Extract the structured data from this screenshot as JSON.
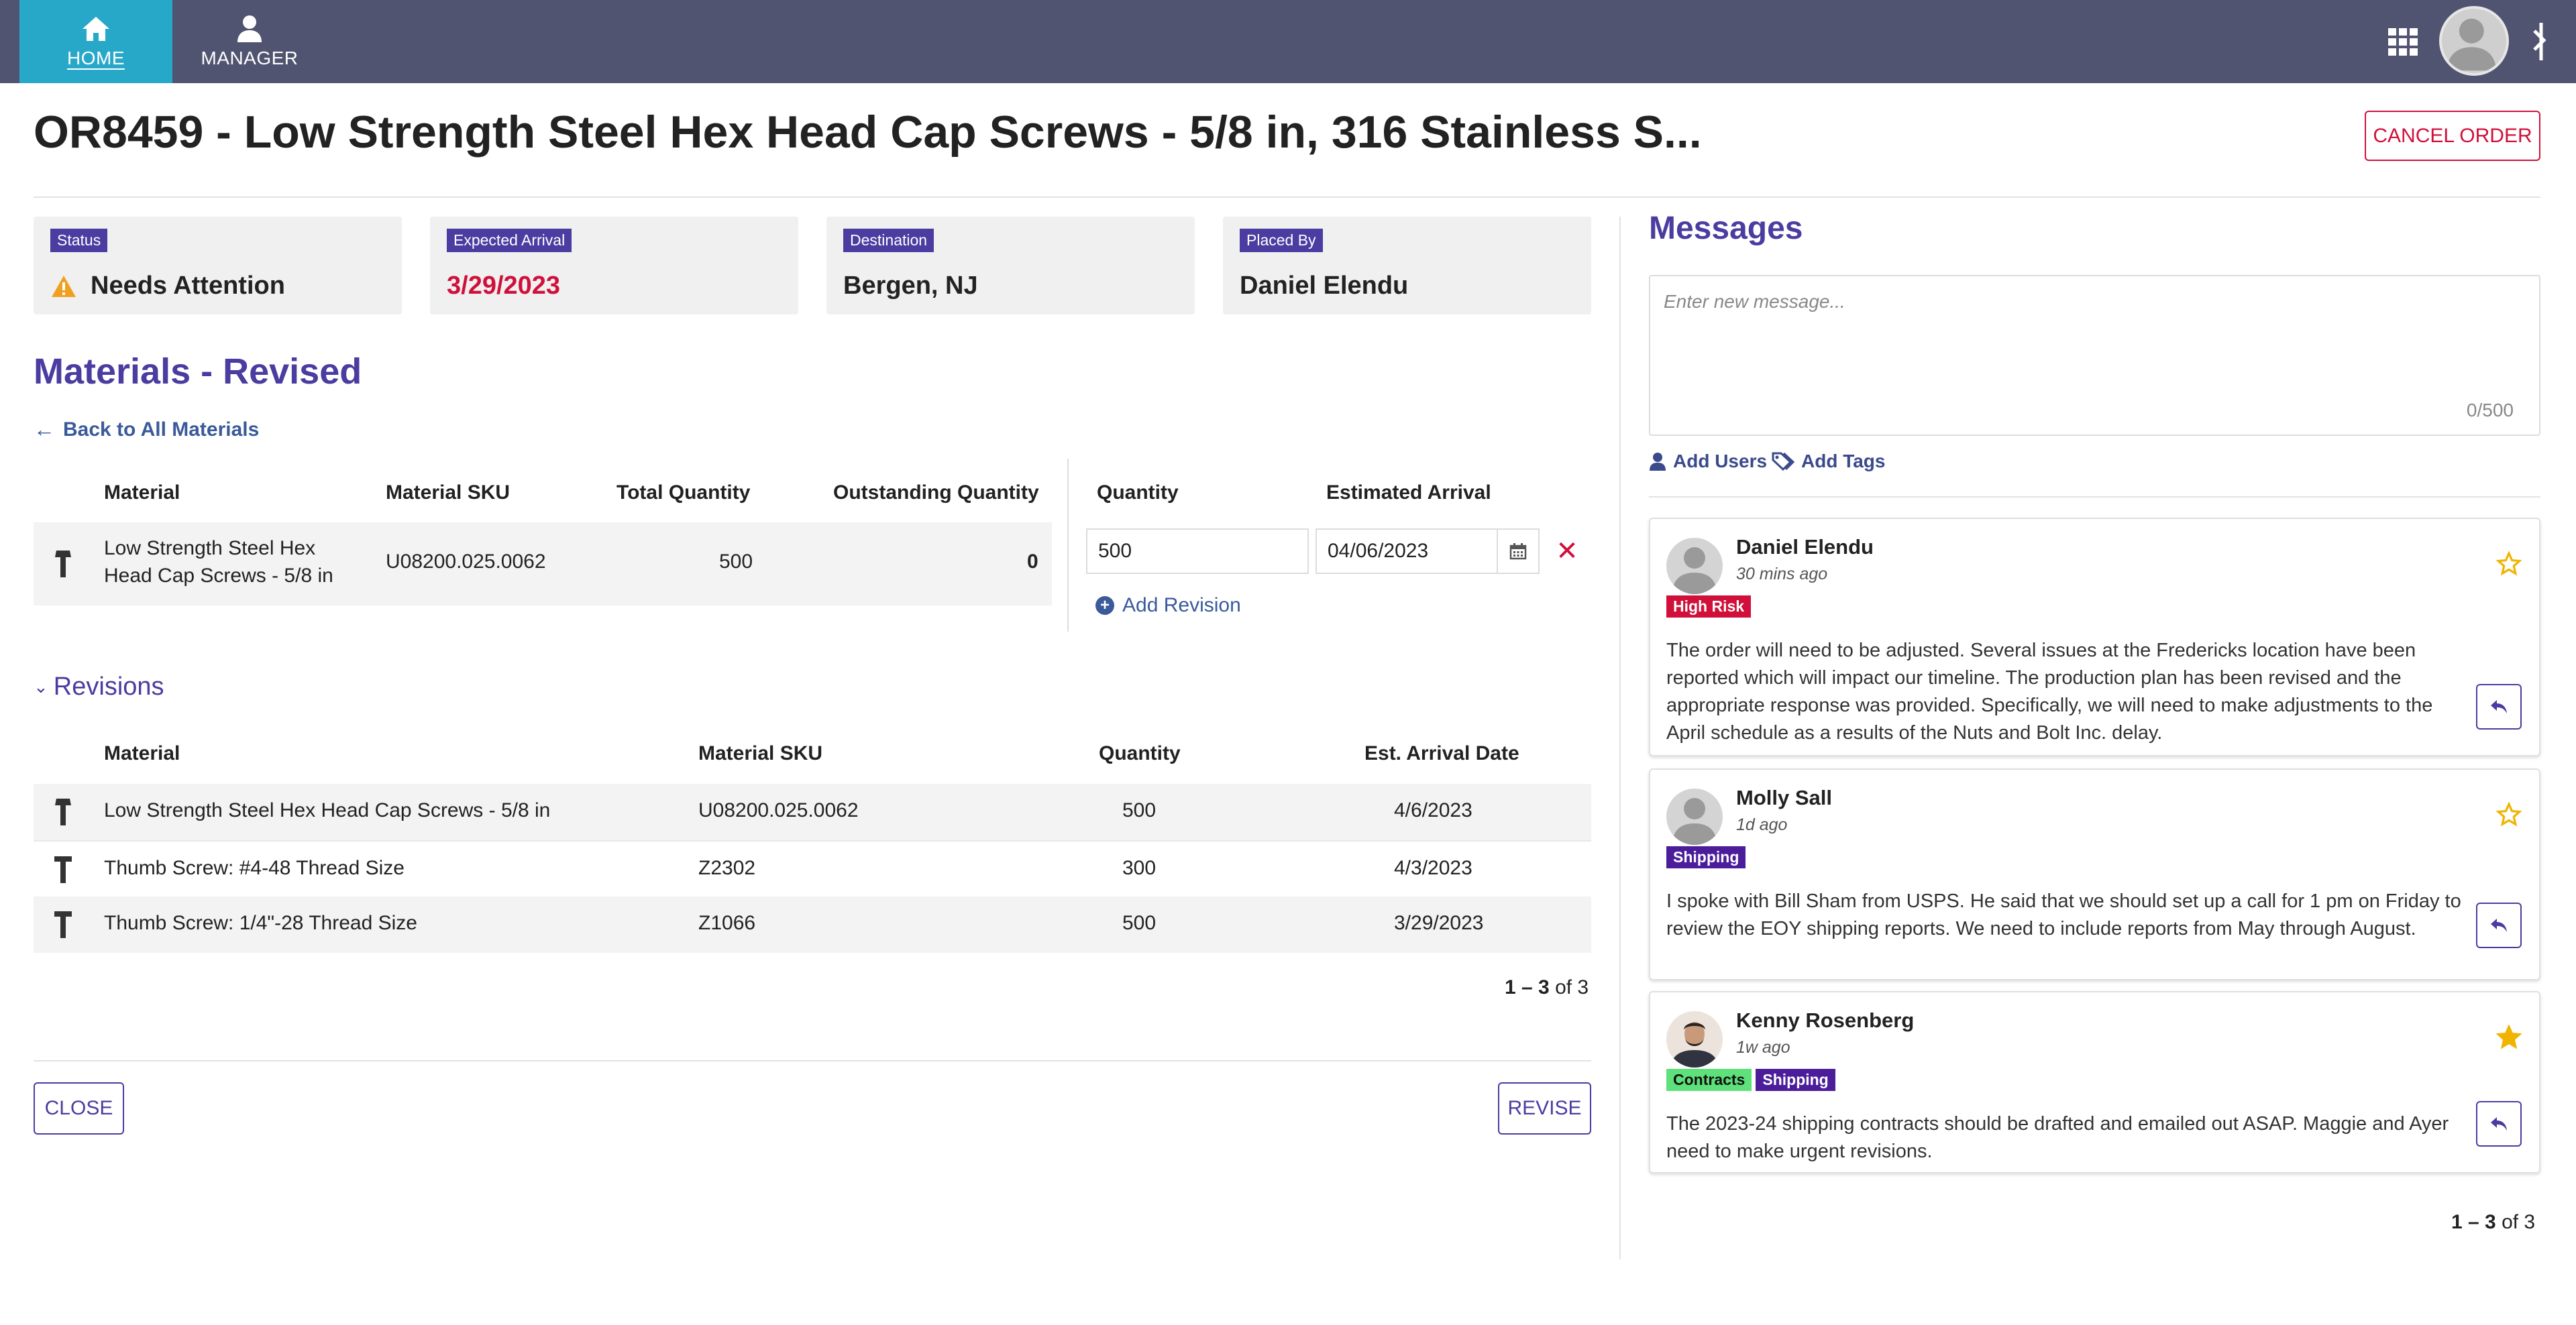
{
  "nav": {
    "home_label": "HOME",
    "manager_label": "MANAGER"
  },
  "header": {
    "title": "OR8459 - Low Strength Steel Hex Head Cap Screws - 5/8 in, 316 Stainless S...",
    "cancel_label": "CANCEL ORDER"
  },
  "info_cards": [
    {
      "label": "Status",
      "value": "Needs Attention"
    },
    {
      "label": "Expected Arrival",
      "value": "3/29/2023"
    },
    {
      "label": "Destination",
      "value": "Bergen, NJ"
    },
    {
      "label": "Placed By",
      "value": "Daniel Elendu"
    }
  ],
  "materials": {
    "title": "Materials - Revised",
    "back_label": "Back to All Materials",
    "headers": {
      "material": "Material",
      "sku": "Material SKU",
      "total_qty": "Total Quantity",
      "outstanding_qty": "Outstanding Quantity",
      "quantity": "Quantity",
      "est_arrival": "Estimated Arrival"
    },
    "row": {
      "name_line1": "Low Strength Steel Hex",
      "name_line2": "Head Cap Screws - 5/8 in",
      "sku": "U08200.025.0062",
      "total": "500",
      "outstanding": "0"
    },
    "edit": {
      "quantity": "500",
      "arrival": "04/06/2023"
    },
    "add_revision_label": "Add Revision"
  },
  "revisions": {
    "title": "Revisions",
    "headers": {
      "material": "Material",
      "sku": "Material SKU",
      "quantity": "Quantity",
      "arrival": "Est. Arrival Date"
    },
    "rows": [
      {
        "material": "Low Strength Steel Hex Head Cap Screws - 5/8 in",
        "sku": "U08200.025.0062",
        "quantity": "500",
        "arrival": "4/6/2023"
      },
      {
        "material": "Thumb Screw: #4-48 Thread Size",
        "sku": "Z2302",
        "quantity": "300",
        "arrival": "4/3/2023"
      },
      {
        "material": "Thumb Screw: 1/4\"-28 Thread Size",
        "sku": "Z1066",
        "quantity": "500",
        "arrival": "3/29/2023"
      }
    ],
    "pager_range": "1 – 3",
    "pager_total": "of 3"
  },
  "footer": {
    "close_label": "CLOSE",
    "revise_label": "REVISE"
  },
  "messages": {
    "title": "Messages",
    "placeholder": "Enter new message...",
    "counter": "0/500",
    "add_users_label": "Add Users",
    "add_tags_label": "Add Tags",
    "items": [
      {
        "name": "Daniel Elendu",
        "time": "30 mins ago",
        "tags": [
          "High Risk"
        ],
        "body": "The order will need to be adjusted. Several issues at the Fredericks location have been reported which will impact our timeline. The production plan has been revised and the appropriate response was provided. Specifically, we will need to make adjustments to the April schedule as a results of the Nuts and Bolt Inc. delay.",
        "starred": false
      },
      {
        "name": "Molly Sall",
        "time": "1d ago",
        "tags": [
          "Shipping"
        ],
        "body": "I spoke with Bill Sham from USPS. He said that we should set up a call for 1 pm on Friday to review the EOY shipping reports. We need to include reports from May through August.",
        "starred": false
      },
      {
        "name": "Kenny Rosenberg",
        "time": "1w ago",
        "tags": [
          "Contracts",
          "Shipping"
        ],
        "body": "The 2023-24 shipping contracts should be drafted and emailed out ASAP. Maggie and Ayer need to make urgent revisions.",
        "starred": true
      }
    ],
    "pager_range": "1 – 3",
    "pager_total": "of 3"
  },
  "colors": {
    "topbar": "#505470",
    "nav_active": "#28a8c8",
    "accent_purple": "#4a3ca0",
    "danger_red": "#d0103a",
    "warning_orange": "#f0a020",
    "star_gold": "#f0b400",
    "tag_high_risk": "#d0103a",
    "tag_shipping": "#4b1d9b",
    "tag_contracts": "#5ee07a"
  },
  "icons": {
    "nav_home": "home-icon",
    "nav_manager": "user-icon",
    "apps": "grid-icon",
    "status": "warning-icon",
    "calendar": "calendar-icon",
    "delete": "close-icon",
    "reply": "reply-icon",
    "star": "star-icon",
    "material": "screw-icon"
  }
}
